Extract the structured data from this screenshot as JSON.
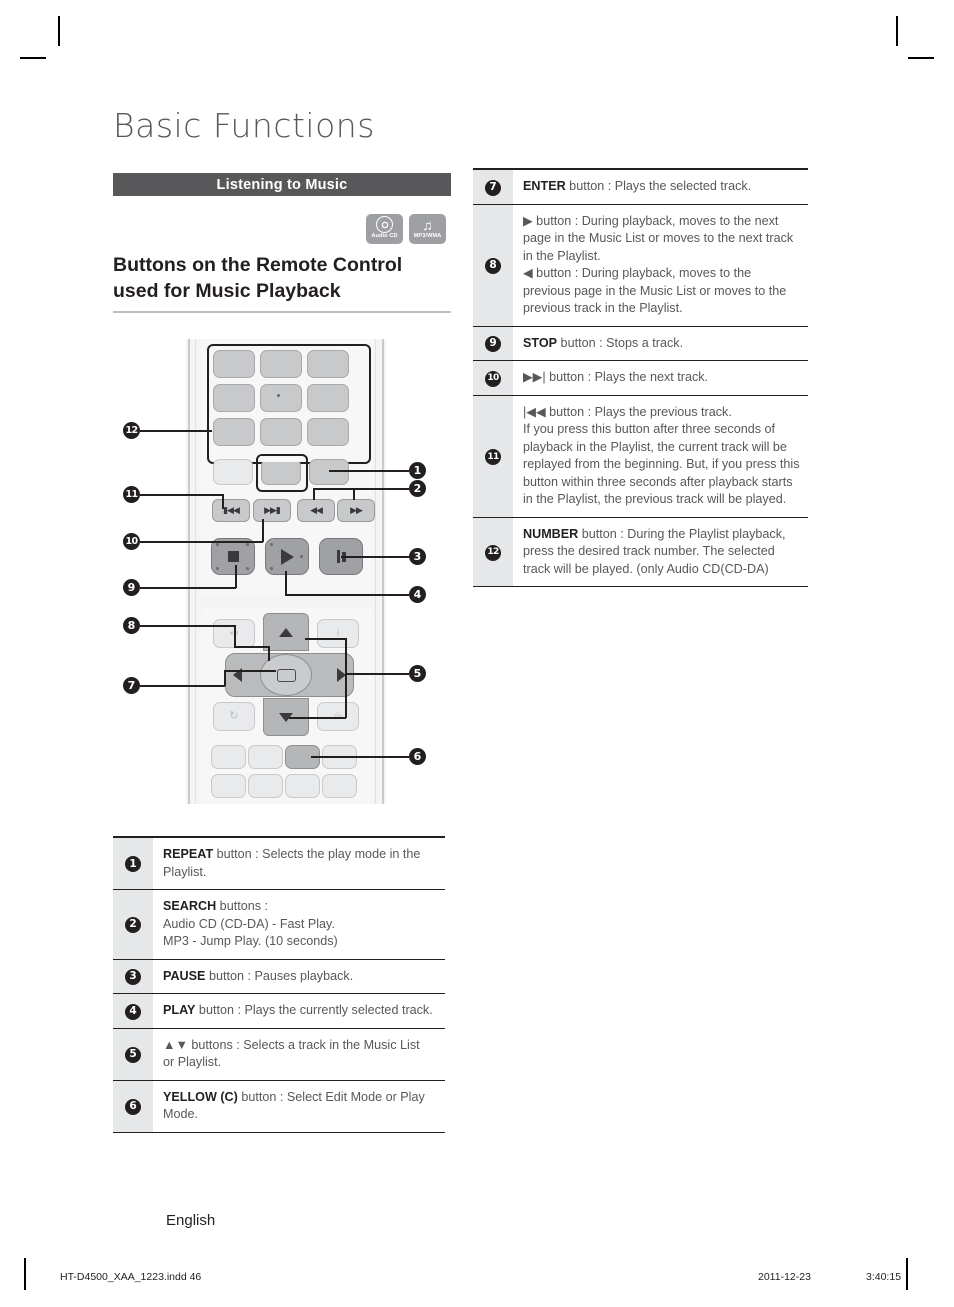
{
  "page": {
    "title": "Basic Functions",
    "section_bar": "Listening to Music",
    "heading": "Buttons on the Remote Control used for Music Playback",
    "language": "English",
    "footer_file": "HT-D4500_XAA_1223.indd   46",
    "footer_date": "2011-12-23",
    "footer_time": "3:40:15",
    "accent_bar_color": "#58585a",
    "number_badge_color": "#231f20",
    "table_numcol_color": "#e6e7e8"
  },
  "disc_icons": [
    {
      "name": "audio-cd-icon",
      "caption": "Audio CD",
      "glyph": "disc"
    },
    {
      "name": "mp3-wma-icon",
      "caption": "MP3/WMA",
      "glyph": "note"
    }
  ],
  "remote_callouts": [
    {
      "num": "1",
      "side": "right"
    },
    {
      "num": "2",
      "side": "right"
    },
    {
      "num": "3",
      "side": "right"
    },
    {
      "num": "4",
      "side": "right"
    },
    {
      "num": "5",
      "side": "right"
    },
    {
      "num": "6",
      "side": "right"
    },
    {
      "num": "7",
      "side": "left"
    },
    {
      "num": "8",
      "side": "left"
    },
    {
      "num": "9",
      "side": "left"
    },
    {
      "num": "10",
      "side": "left"
    },
    {
      "num": "11",
      "side": "left"
    },
    {
      "num": "12",
      "side": "left"
    }
  ],
  "table_left": [
    {
      "num": "1",
      "lines": [
        {
          "bold": "REPEAT",
          "rest": " button : Selects the play mode in the"
        },
        {
          "bold": "",
          "rest": "Playlist."
        }
      ]
    },
    {
      "num": "2",
      "lines": [
        {
          "bold": "SEARCH",
          "rest": " buttons :"
        },
        {
          "bold": "",
          "rest": "Audio CD (CD-DA) - Fast Play."
        },
        {
          "bold": "",
          "rest": "MP3 - Jump Play. (10 seconds)"
        }
      ]
    },
    {
      "num": "3",
      "lines": [
        {
          "bold": "PAUSE",
          "rest": " button : Pauses playback."
        }
      ]
    },
    {
      "num": "4",
      "lines": [
        {
          "bold": "PLAY",
          "rest": " button : Plays the currently selected track."
        }
      ]
    },
    {
      "num": "5",
      "lines": [
        {
          "bold": "",
          "rest": "▲▼ buttons : Selects a track in the Music List"
        },
        {
          "bold": "",
          "rest": "or Playlist."
        }
      ]
    },
    {
      "num": "6",
      "lines": [
        {
          "bold": "YELLOW (C)",
          "rest": " button : Select Edit Mode or Play"
        },
        {
          "bold": "",
          "rest": "Mode."
        }
      ]
    }
  ],
  "table_right": [
    {
      "num": "7",
      "lines": [
        {
          "bold": "ENTER",
          "rest": " button : Plays the selected track."
        }
      ]
    },
    {
      "num": "8",
      "lines": [
        {
          "bold": "",
          "rest": "▶ button : During playback, moves to the next"
        },
        {
          "bold": "",
          "rest": "page in the Music List or moves to the next track"
        },
        {
          "bold": "",
          "rest": "in the Playlist."
        },
        {
          "bold": "",
          "rest": "◀ button : During playback, moves to the"
        },
        {
          "bold": "",
          "rest": "previous page in the Music List or moves to the"
        },
        {
          "bold": "",
          "rest": "previous track in the Playlist."
        }
      ]
    },
    {
      "num": "9",
      "lines": [
        {
          "bold": "STOP",
          "rest": " button : Stops a track."
        }
      ]
    },
    {
      "num": "10",
      "lines": [
        {
          "bold": "",
          "rest": "▶▶| button : Plays the next track."
        }
      ]
    },
    {
      "num": "11",
      "lines": [
        {
          "bold": "",
          "rest": "|◀◀ button : Plays the previous track."
        },
        {
          "bold": "",
          "rest": "If you press this button after three seconds of"
        },
        {
          "bold": "",
          "rest": "playback in the Playlist, the current track will be"
        },
        {
          "bold": "",
          "rest": "replayed from the beginning. But, if you press this"
        },
        {
          "bold": "",
          "rest": "button within three seconds after playback starts"
        },
        {
          "bold": "",
          "rest": "in the Playlist, the previous track will be played."
        }
      ]
    },
    {
      "num": "12",
      "lines": [
        {
          "bold": "NUMBER",
          "rest": " button : During the Playlist playback,"
        },
        {
          "bold": "",
          "rest": "press the desired track number. The selected"
        },
        {
          "bold": "",
          "rest": "track will be played. (only Audio CD(CD-DA)"
        }
      ]
    }
  ]
}
